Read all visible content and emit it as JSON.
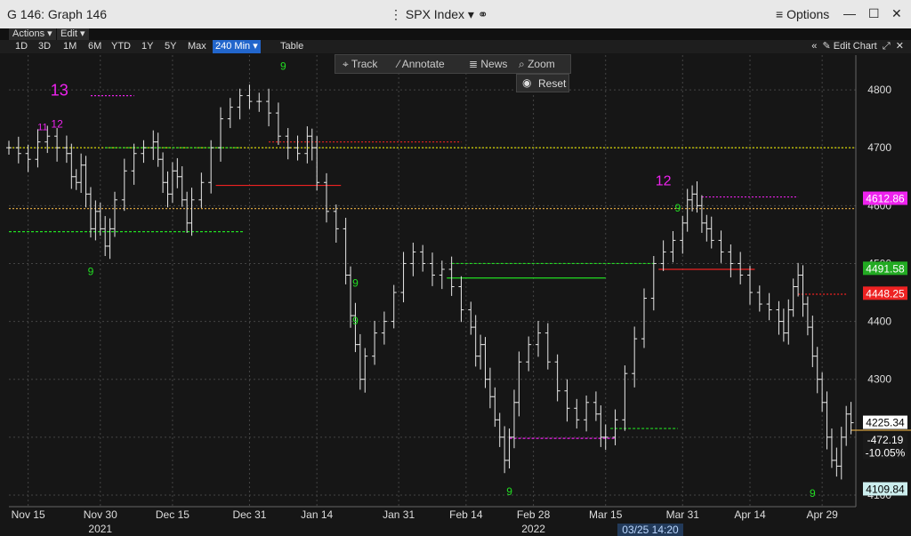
{
  "window": {
    "title": "G 146: Graph 146",
    "security": "SPX Index",
    "options_label": "Options",
    "min_icon": "minimize-icon",
    "max_icon": "maximize-icon",
    "close_icon": "close-icon"
  },
  "menus": {
    "actions": "Actions",
    "edit": "Edit"
  },
  "ranges": [
    "1D",
    "3D",
    "1M",
    "6M",
    "YTD",
    "1Y",
    "5Y",
    "Max"
  ],
  "interval": "240 Min",
  "table_label": "Table",
  "edit_chart_label": "Edit Chart",
  "float_toolbar": {
    "track": "Track",
    "annotate": "Annotate",
    "news": "News",
    "zoom": "Zoom",
    "reset": "Reset"
  },
  "colors": {
    "price": "#e8e8e8",
    "buy_count": "#22dd22",
    "sell_count": "#ee22ee",
    "red": "#ee2222",
    "yellow": "#e6e600",
    "orange": "#d4a040",
    "grid": "#333333"
  },
  "chart_data": {
    "type": "bar",
    "xlabel": "",
    "ylabel": "",
    "ylim": [
      4080,
      4860
    ],
    "y_ticks": [
      4100,
      4200,
      4300,
      4400,
      4500,
      4600,
      4700,
      4800
    ],
    "x_ticks": [
      {
        "label": "Nov 15",
        "x": 0
      },
      {
        "label": "Nov 30",
        "x": 15
      },
      {
        "label": "Dec 15",
        "x": 30
      },
      {
        "label": "Dec 31",
        "x": 46
      },
      {
        "label": "Jan 14",
        "x": 60
      },
      {
        "label": "Jan 31",
        "x": 77
      },
      {
        "label": "Feb 14",
        "x": 91
      },
      {
        "label": "Feb 28",
        "x": 105
      },
      {
        "label": "Mar 15",
        "x": 120
      },
      {
        "label": "Mar 31",
        "x": 136
      },
      {
        "label": "Apr 14",
        "x": 150
      },
      {
        "label": "Apr 29",
        "x": 165
      }
    ],
    "year_labels": [
      {
        "label": "2021",
        "x": 15
      },
      {
        "label": "2022",
        "x": 105
      }
    ],
    "xlim": [
      -4,
      172
    ],
    "closes": [
      [
        -4,
        4700
      ],
      [
        -2,
        4690
      ],
      [
        0,
        4680
      ],
      [
        2,
        4710
      ],
      [
        4,
        4720
      ],
      [
        6,
        4700
      ],
      [
        8,
        4690
      ],
      [
        9,
        4650
      ],
      [
        10,
        4640
      ],
      [
        11,
        4670
      ],
      [
        12,
        4620
      ],
      [
        13,
        4560
      ],
      [
        14,
        4590
      ],
      [
        15,
        4560
      ],
      [
        16,
        4530
      ],
      [
        17,
        4560
      ],
      [
        18,
        4610
      ],
      [
        20,
        4660
      ],
      [
        22,
        4690
      ],
      [
        24,
        4700
      ],
      [
        26,
        4710
      ],
      [
        27,
        4680
      ],
      [
        28,
        4640
      ],
      [
        29,
        4620
      ],
      [
        30,
        4660
      ],
      [
        31,
        4650
      ],
      [
        32,
        4610
      ],
      [
        33,
        4570
      ],
      [
        34,
        4610
      ],
      [
        36,
        4640
      ],
      [
        38,
        4700
      ],
      [
        40,
        4750
      ],
      [
        42,
        4770
      ],
      [
        44,
        4790
      ],
      [
        46,
        4780
      ],
      [
        48,
        4780
      ],
      [
        50,
        4760
      ],
      [
        52,
        4720
      ],
      [
        54,
        4700
      ],
      [
        56,
        4690
      ],
      [
        58,
        4720
      ],
      [
        59,
        4700
      ],
      [
        60,
        4640
      ],
      [
        62,
        4590
      ],
      [
        64,
        4560
      ],
      [
        66,
        4480
      ],
      [
        67,
        4410
      ],
      [
        68,
        4360
      ],
      [
        69,
        4300
      ],
      [
        70,
        4340
      ],
      [
        72,
        4380
      ],
      [
        74,
        4400
      ],
      [
        76,
        4450
      ],
      [
        78,
        4500
      ],
      [
        80,
        4520
      ],
      [
        82,
        4500
      ],
      [
        84,
        4480
      ],
      [
        86,
        4490
      ],
      [
        88,
        4460
      ],
      [
        90,
        4420
      ],
      [
        92,
        4390
      ],
      [
        93,
        4340
      ],
      [
        94,
        4360
      ],
      [
        95,
        4300
      ],
      [
        96,
        4270
      ],
      [
        97,
        4230
      ],
      [
        98,
        4200
      ],
      [
        99,
        4160
      ],
      [
        100,
        4200
      ],
      [
        101,
        4260
      ],
      [
        102,
        4330
      ],
      [
        104,
        4360
      ],
      [
        106,
        4380
      ],
      [
        108,
        4330
      ],
      [
        110,
        4280
      ],
      [
        112,
        4250
      ],
      [
        114,
        4230
      ],
      [
        116,
        4260
      ],
      [
        118,
        4240
      ],
      [
        119,
        4200
      ],
      [
        120,
        4200
      ],
      [
        122,
        4230
      ],
      [
        124,
        4310
      ],
      [
        126,
        4370
      ],
      [
        128,
        4440
      ],
      [
        130,
        4500
      ],
      [
        132,
        4520
      ],
      [
        134,
        4540
      ],
      [
        136,
        4570
      ],
      [
        137,
        4610
      ],
      [
        138,
        4620
      ],
      [
        139,
        4600
      ],
      [
        140,
        4570
      ],
      [
        141,
        4560
      ],
      [
        142,
        4540
      ],
      [
        144,
        4520
      ],
      [
        146,
        4500
      ],
      [
        148,
        4480
      ],
      [
        150,
        4450
      ],
      [
        152,
        4430
      ],
      [
        154,
        4420
      ],
      [
        156,
        4400
      ],
      [
        157,
        4380
      ],
      [
        158,
        4420
      ],
      [
        159,
        4460
      ],
      [
        160,
        4480
      ],
      [
        161,
        4430
      ],
      [
        162,
        4390
      ],
      [
        163,
        4340
      ],
      [
        164,
        4300
      ],
      [
        165,
        4260
      ],
      [
        166,
        4200
      ],
      [
        167,
        4160
      ],
      [
        168,
        4150
      ],
      [
        169,
        4200
      ],
      [
        170,
        4240
      ],
      [
        171,
        4225
      ]
    ],
    "horizontal_levels": [
      {
        "y": 4700,
        "color": "#e6e600",
        "style": "dotted"
      },
      {
        "y": 4595,
        "color": "#d4a040",
        "style": "dotted"
      },
      {
        "y": 4212,
        "color": "#d4a040",
        "style": "solid",
        "from": 171
      },
      {
        "y": 4790,
        "color": "#ee22ee",
        "style": "dotted",
        "from": 13,
        "to": 22
      },
      {
        "y": 4700,
        "color": "#22dd22",
        "style": "dashed",
        "from": 16,
        "to": 44
      },
      {
        "y": 4555,
        "color": "#22dd22",
        "style": "dashed",
        "from": -4,
        "to": 45
      },
      {
        "y": 4635,
        "color": "#ee2222",
        "style": "solid",
        "from": 39,
        "to": 65
      },
      {
        "y": 4710,
        "color": "#ee2222",
        "style": "dotted",
        "from": 50,
        "to": 90
      },
      {
        "y": 4475,
        "color": "#22dd22",
        "style": "solid",
        "from": 87,
        "to": 120
      },
      {
        "y": 4500,
        "color": "#22dd22",
        "style": "dashed",
        "from": 88,
        "to": 130
      },
      {
        "y": 4215,
        "color": "#22dd22",
        "style": "dashed",
        "from": 121,
        "to": 135
      },
      {
        "y": 4198,
        "color": "#ee22ee",
        "style": "dashed",
        "from": 100,
        "to": 122
      },
      {
        "y": 4490,
        "color": "#ee2222",
        "style": "solid",
        "from": 131,
        "to": 151
      },
      {
        "y": 4615,
        "color": "#ee22ee",
        "style": "dotted",
        "from": 140,
        "to": 160
      },
      {
        "y": 4447,
        "color": "#ee2222",
        "style": "dotted",
        "from": 160,
        "to": 170
      }
    ],
    "right_labels": [
      {
        "text": "4612.86",
        "y": 4612,
        "bg": "#ee22ee",
        "fg": "#ffffff"
      },
      {
        "text": "4491.58",
        "y": 4491,
        "bg": "#22aa22",
        "fg": "#ffffff"
      },
      {
        "text": "4448.25",
        "y": 4448,
        "bg": "#ee2222",
        "fg": "#ffffff"
      },
      {
        "text": "4225.34",
        "y": 4225,
        "bg": "#ffffff",
        "fg": "#000000"
      },
      {
        "text": "-472.19",
        "y": 4195,
        "bg": "#1a1a1a",
        "fg": "#ffffff"
      },
      {
        "text": "-10.05%",
        "y": 4173,
        "bg": "#1a1a1a",
        "fg": "#ffffff"
      },
      {
        "text": "4109.84",
        "y": 4110,
        "bg": "#cceeee",
        "fg": "#000000"
      }
    ],
    "annotations": [
      {
        "text": "13",
        "x": 6.5,
        "y": 4790,
        "color": "#ee22ee",
        "size": 18
      },
      {
        "text": "12",
        "x": 6,
        "y": 4735,
        "color": "#ee22ee",
        "size": 12
      },
      {
        "text": "11",
        "x": 3,
        "y": 4730,
        "color": "#ee22ee",
        "size": 11
      },
      {
        "text": "9",
        "x": 13,
        "y": 4480,
        "color": "#22dd22",
        "size": 12
      },
      {
        "text": "9",
        "x": 53,
        "y": 4835,
        "color": "#22dd22",
        "size": 12
      },
      {
        "text": "9",
        "x": 68,
        "y": 4460,
        "color": "#22dd22",
        "size": 12
      },
      {
        "text": "9",
        "x": 68,
        "y": 4395,
        "color": "#22dd22",
        "size": 12
      },
      {
        "text": "9",
        "x": 100,
        "y": 4100,
        "color": "#22dd22",
        "size": 12
      },
      {
        "text": "9",
        "x": 100,
        "y": 4015,
        "color": "#22dd22",
        "size": 12
      },
      {
        "text": "9",
        "x": 135,
        "y": 4590,
        "color": "#22dd22",
        "size": 12
      },
      {
        "text": "12",
        "x": 132,
        "y": 4635,
        "color": "#ee22ee",
        "size": 16
      },
      {
        "text": "9",
        "x": 163,
        "y": 4097,
        "color": "#22dd22",
        "size": 12
      }
    ],
    "tool_readout": "03/25 14:20"
  }
}
